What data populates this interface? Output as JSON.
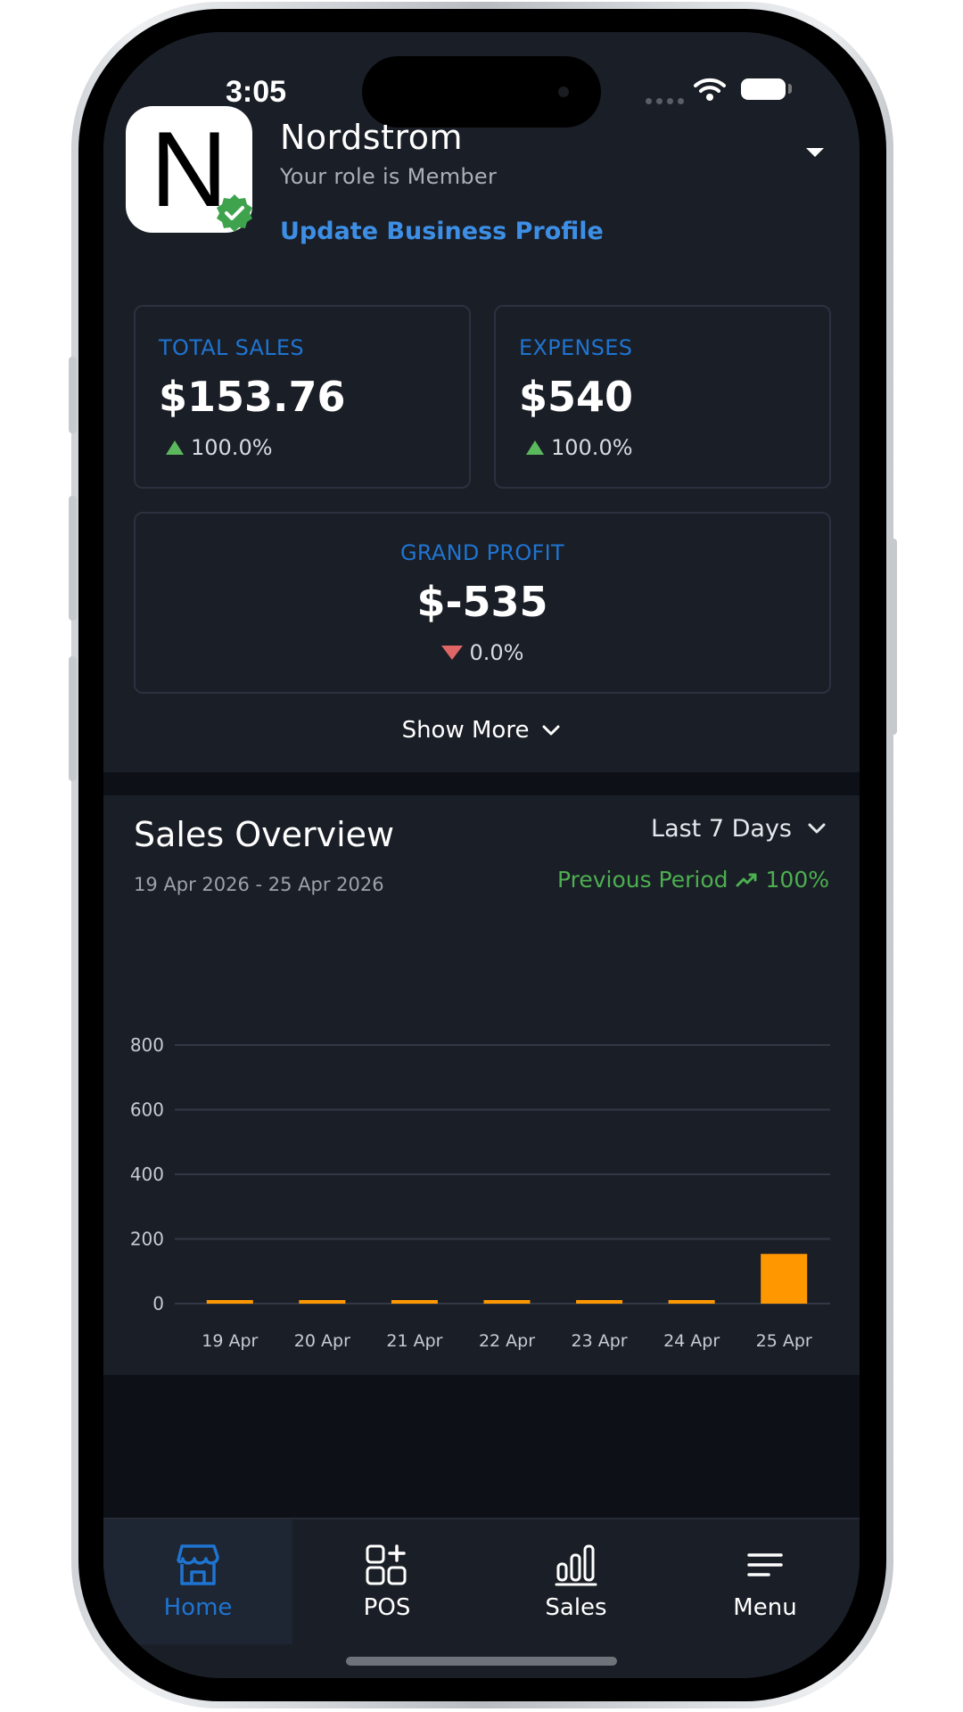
{
  "status_bar": {
    "time": "3:05"
  },
  "business": {
    "logo_letter": "N",
    "name": "Nordstrom",
    "role": "Your role is Member",
    "update_link": "Update Business Profile"
  },
  "stats": {
    "total_sales": {
      "label": "TOTAL SALES",
      "value": "$153.76",
      "change": "100.0%",
      "trend": "up"
    },
    "expenses": {
      "label": "EXPENSES",
      "value": "$540",
      "change": "100.0%",
      "trend": "up"
    },
    "grand_profit": {
      "label": "GRAND PROFIT",
      "value": "$-535",
      "change": "0.0%",
      "trend": "down"
    }
  },
  "show_more_label": "Show More",
  "sales_overview": {
    "title": "Sales Overview",
    "date_range": "19 Apr 2026 - 25 Apr 2026",
    "period_select": "Last 7 Days",
    "previous_period_label": "Previous Period",
    "previous_period_change": "100%"
  },
  "chart_data": {
    "type": "bar",
    "title": "Sales Overview",
    "categories": [
      "19 Apr",
      "20 Apr",
      "21 Apr",
      "22 Apr",
      "23 Apr",
      "24 Apr",
      "25 Apr"
    ],
    "values": [
      0,
      0,
      0,
      0,
      0,
      0,
      153.76
    ],
    "y_ticks": [
      0,
      200,
      400,
      600,
      800
    ],
    "ylim": [
      0,
      800
    ],
    "grid": true,
    "bar_color": "#ff9800"
  },
  "tabs": [
    {
      "label": "Home",
      "icon": "store-icon",
      "active": true
    },
    {
      "label": "POS",
      "icon": "pos-grid-icon",
      "active": false
    },
    {
      "label": "Sales",
      "icon": "bar-chart-icon",
      "active": false
    },
    {
      "label": "Menu",
      "icon": "menu-icon",
      "active": false
    }
  ],
  "colors": {
    "background": "#1a1e26",
    "accent": "#1f74d1",
    "link": "#3d8fe6",
    "positive": "#5cb85c",
    "negative": "#e06666",
    "bar": "#ff9800"
  }
}
